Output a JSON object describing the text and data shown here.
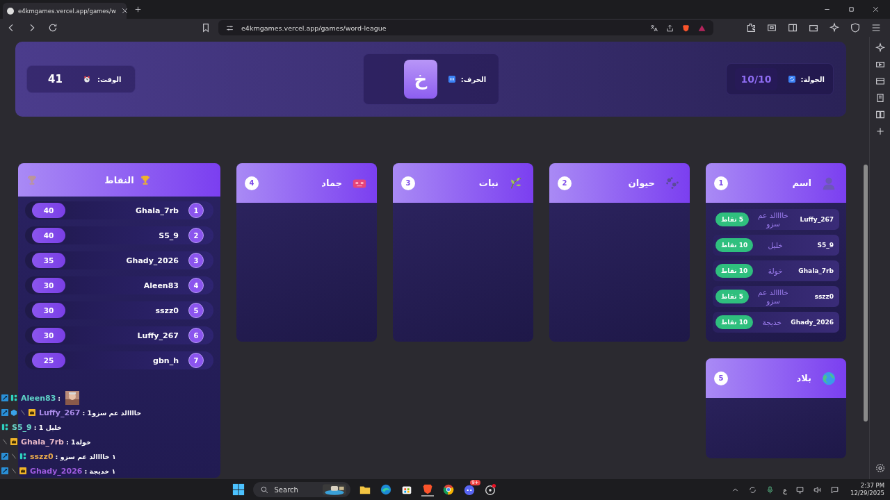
{
  "browser": {
    "tab": {
      "title": "e4kmgames.vercel.app/games/w"
    },
    "url": "e4kmgames.vercel.app/games/word-league"
  },
  "header": {
    "round": {
      "label": "الجولة:",
      "value": "10/10"
    },
    "letter": {
      "label": "الحرف:",
      "value": "خ"
    },
    "timer": {
      "label": "الوقت:",
      "value": "41"
    }
  },
  "categories": [
    {
      "kind": "name",
      "title": "اسم",
      "number": "1",
      "answers": [
        {
          "player": "Luffy_267",
          "answer": "خاااالد عم سزو",
          "points": "5 نقاط"
        },
        {
          "player": "S5_9",
          "answer": "خليل",
          "points": "10 نقاط"
        },
        {
          "player": "Ghala_7rb",
          "answer": "خولة",
          "points": "10 نقاط"
        },
        {
          "player": "sszz0",
          "answer": "خاااالد عم سزو",
          "points": "5 نقاط"
        },
        {
          "player": "Ghady_2026",
          "answer": "خديجة",
          "points": "10 نقاط"
        }
      ]
    },
    {
      "kind": "animal",
      "title": "حيوان",
      "number": "2"
    },
    {
      "kind": "plant",
      "title": "نبات",
      "number": "3"
    },
    {
      "kind": "object",
      "title": "جماد",
      "number": "4"
    },
    {
      "kind": "country",
      "title": "بلاد",
      "number": "5"
    }
  ],
  "scoreboard": {
    "title": "النقاط",
    "rows": [
      {
        "rank": "1",
        "name": "Ghala_7rb",
        "score": "40"
      },
      {
        "rank": "2",
        "name": "S5_9",
        "score": "40"
      },
      {
        "rank": "3",
        "name": "Ghady_2026",
        "score": "35"
      },
      {
        "rank": "4",
        "name": "Aleen83",
        "score": "30"
      },
      {
        "rank": "5",
        "name": "sszz0",
        "score": "30"
      },
      {
        "rank": "6",
        "name": "Luffy_267",
        "score": "30"
      },
      {
        "rank": "7",
        "name": "gbn_h",
        "score": "25"
      }
    ]
  },
  "chat": [
    {
      "badges": [
        {
          "kind": "mod"
        },
        {
          "kind": "partner"
        }
      ],
      "user": "Aleen83",
      "color": "#5fd3c8",
      "message": ":",
      "emote": true
    },
    {
      "badges": [
        {
          "kind": "mod"
        },
        {
          "kind": "gem"
        },
        {
          "kind": "slash"
        },
        {
          "kind": "crown"
        }
      ],
      "user": "Luffy_267",
      "color": "#a98be8",
      "message": ": خاااالد عم سزو1"
    },
    {
      "badges": [
        {
          "kind": "partner"
        }
      ],
      "user": "S5_9",
      "color": "#6ad7c9",
      "message": ": خليل 1"
    },
    {
      "badges": [
        {
          "kind": "slash"
        },
        {
          "kind": "crown"
        }
      ],
      "user": "Ghala_7rb",
      "color": "#e7b8c8",
      "message": ": خولة1"
    },
    {
      "badges": [
        {
          "kind": "mod"
        },
        {
          "kind": "slash"
        },
        {
          "kind": "partner"
        }
      ],
      "user": "sszz0",
      "color": "#e8a94b",
      "message": ": ١ خاااالد عم سزو"
    },
    {
      "badges": [
        {
          "kind": "mod"
        },
        {
          "kind": "slash"
        },
        {
          "kind": "crown"
        }
      ],
      "user": "Ghady_2026",
      "color": "#a05ce0",
      "message": ": ١ خديجة"
    }
  ],
  "taskbar": {
    "search": "Search",
    "notification": "9+",
    "language": "ع",
    "time": "2:37 PM",
    "date": "12/29/2025"
  }
}
